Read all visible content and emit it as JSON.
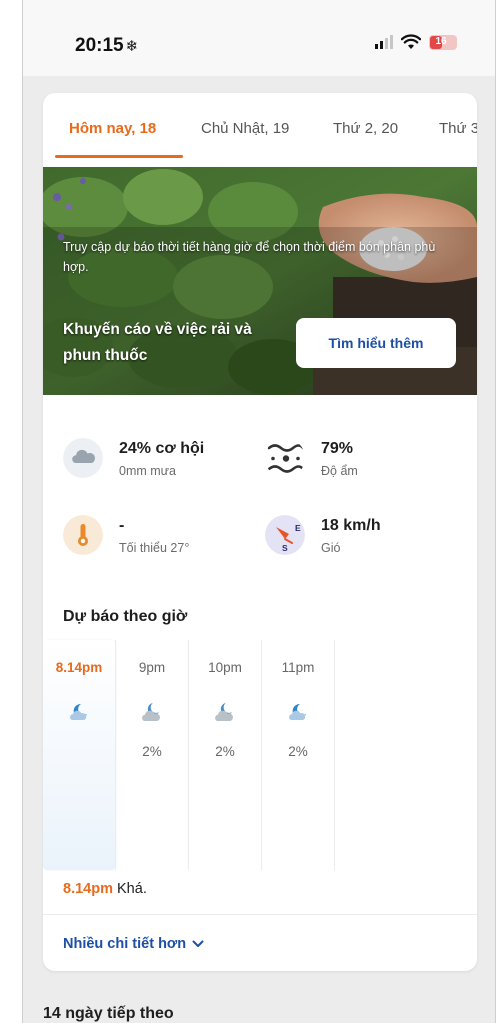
{
  "status_bar": {
    "time": "20:15",
    "time_icon": "snowflake-icon",
    "battery_level": "16",
    "signal_bars_active": 2
  },
  "tabs": [
    {
      "label": "Hôm nay, 18",
      "active": true
    },
    {
      "label": "Chủ Nhật, 19",
      "active": false
    },
    {
      "label": "Thứ 2, 20",
      "active": false
    },
    {
      "label": "Thứ 3",
      "active": false
    }
  ],
  "banner": {
    "description": "Truy cập dự báo thời tiết hàng giờ để chọn thời điểm bón phân phù hợp.",
    "title": "Khuyến cáo về việc rải và phun thuốc",
    "button_label": "Tìm hiểu thêm"
  },
  "stats": {
    "rain": {
      "value": "24% cơ hội",
      "label": "0mm mưa",
      "icon": "cloud-icon"
    },
    "humidity": {
      "value": "79%",
      "label": "Độ ẩm",
      "icon": "humidity-icon"
    },
    "temperature": {
      "value": "-",
      "label": "Tối thiểu 27°",
      "icon": "thermometer-icon"
    },
    "wind": {
      "value": "18 km/h",
      "label": "Gió",
      "icon": "wind-compass-icon",
      "direction_labels": [
        "E",
        "S"
      ]
    }
  },
  "hourly": {
    "title": "Dự báo theo giờ",
    "items": [
      {
        "time": "8.14pm",
        "icon": "moon-cloud-icon",
        "precip": ""
      },
      {
        "time": "9pm",
        "icon": "cloud-moon-icon",
        "precip": "2%"
      },
      {
        "time": "10pm",
        "icon": "cloud-moon-icon",
        "precip": "2%"
      },
      {
        "time": "11pm",
        "icon": "moon-cloud-icon",
        "precip": "2%"
      }
    ],
    "summary_time": "8.14pm",
    "summary_text": "Khá.",
    "more_label": "Nhiều chi tiết hơn"
  },
  "next_section": {
    "title": "14 ngày tiếp theo"
  },
  "colors": {
    "accent": "#e86a1c",
    "link": "#1d4fa6",
    "background": "#ececec"
  }
}
